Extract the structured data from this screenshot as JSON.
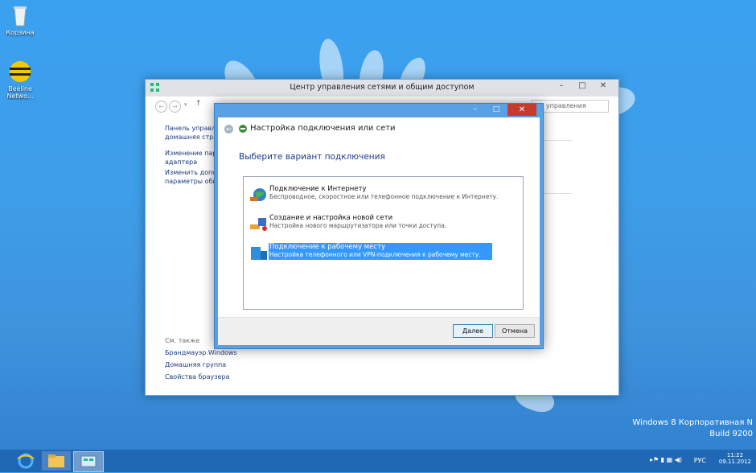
{
  "desktop": {
    "icons": [
      {
        "label": "Корзина"
      },
      {
        "label": "Beeline Netwo..."
      }
    ],
    "watermark": {
      "line1": "Windows 8 Корпоративная N",
      "line2": "Build 9200"
    }
  },
  "control_panel": {
    "title": "Центр управления сетями и общим доступом",
    "search_placeholder": "Поиск в панели управления",
    "search_visible": "ли управления",
    "sidebar_links": [
      {
        "line1": "Панель управлен",
        "line2": "домашняя стран"
      },
      {
        "line1": "Изменение парам",
        "line2": "адаптера"
      },
      {
        "line1": "Изменить допол",
        "line2": "параметры общи"
      }
    ],
    "see_also_label": "См. также",
    "see_also_links": [
      "Брандмауэр Windows",
      "Домашняя группа",
      "Свойства браузера"
    ]
  },
  "dialog": {
    "title": "Настройка подключения или сети",
    "heading": "Выберите вариант подключения",
    "options": [
      {
        "title": "Подключение к Интернету",
        "desc": "Беспроводное, скоростное или телефонное подключение к Интернету."
      },
      {
        "title": "Создание и настройка новой сети",
        "desc": "Настройка нового маршрутизатора или точки доступа."
      },
      {
        "title": "Подключение к рабочему месту",
        "desc": "Настройка телефонного или VPN-подключения к рабочему месту."
      }
    ],
    "selected_index": 2,
    "next_label": "Далее",
    "cancel_label": "Отмена"
  },
  "taskbar": {
    "lang": "РУС",
    "time": "11:22",
    "date": "09.11.2012"
  }
}
